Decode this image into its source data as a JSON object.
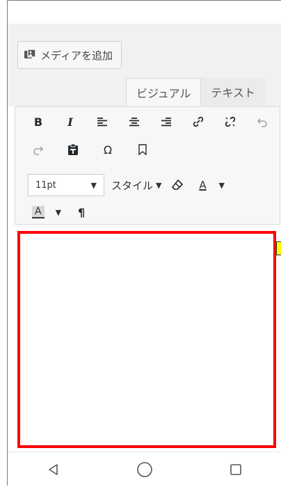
{
  "media_button": {
    "label": "メディアを追加",
    "icon": "media-icon"
  },
  "tabs": [
    {
      "label": "ビジュアル",
      "active": true
    },
    {
      "label": "テキスト",
      "active": false
    }
  ],
  "toolbar": {
    "bold": "B",
    "italic": "I",
    "omega": "Ω",
    "font_size": "11pt",
    "style_label": "スタイル",
    "text_color": "A",
    "bg_color": "A",
    "pilcrow": "¶"
  },
  "colors": {
    "editor_border": "#ff0000",
    "marker": "#ffff00",
    "toolbar_bg": "#f7f7f7",
    "band_bg": "#f1f1f1"
  }
}
